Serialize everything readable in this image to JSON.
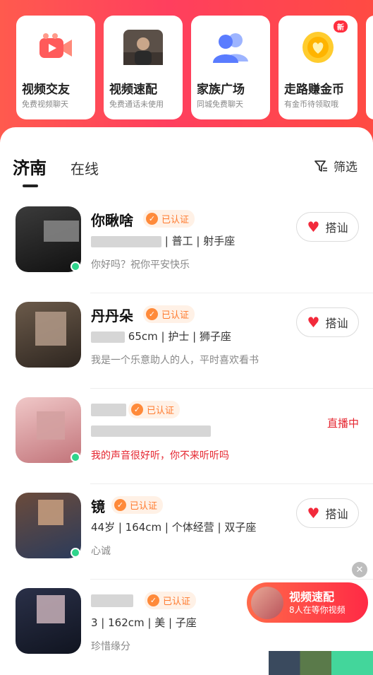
{
  "feature_cards": [
    {
      "title": "视频交友",
      "sub": "免费视频聊天",
      "icon": "video-camera-icon"
    },
    {
      "title": "视频速配",
      "sub": "免费通话未使用",
      "icon": "photo-avatar-icon"
    },
    {
      "title": "家族广场",
      "sub": "同城免费聊天",
      "icon": "family-group-icon"
    },
    {
      "title": "走路赚金币",
      "sub": "有金币待领取哦",
      "icon": "gold-coin-icon",
      "badge": "新"
    }
  ],
  "tabs": {
    "active": "济南",
    "other": "在线"
  },
  "filter_label": "筛选",
  "verified_label": "已认证",
  "chat_label": "搭讪",
  "users": [
    {
      "name": "你瞅啥",
      "info_visible": "| 普工 | 射手座",
      "status": "你好吗？祝你平安快乐",
      "online": true,
      "action": "chat"
    },
    {
      "name": "丹丹朵",
      "info_visible": "65cm | 护士 | 狮子座",
      "status": "我是一个乐意助人的人，平时喜欢看书",
      "online": false,
      "action": "chat"
    },
    {
      "name": "",
      "info_visible": "",
      "status": "我的声音很好听，你不来听听吗",
      "online": true,
      "action": "live",
      "live_label": "直播中"
    },
    {
      "name": "镜",
      "info_visible": "44岁 | 164cm | 个体经营 | 双子座",
      "status": "心诚",
      "online": true,
      "action": "chat"
    },
    {
      "name": "",
      "info_visible": "3 | 162cm | 美 | 子座",
      "status": "珍惜缘分",
      "online": false,
      "action": "chat"
    }
  ],
  "floating": {
    "title": "视频速配",
    "sub": "8人在等你视频"
  },
  "colors": {
    "accent": "#ff3f5e",
    "verified": "#ff7a2e",
    "online": "#2fd58c",
    "heart": "#f22a3b"
  }
}
